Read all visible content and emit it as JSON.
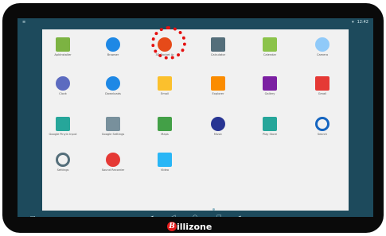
{
  "statusbar": {
    "menu_icon": "menu-icon",
    "time": "12:42"
  },
  "apps": [
    {
      "label": "ApkInstaller",
      "icon": "android-icon",
      "color": "#7cb342"
    },
    {
      "label": "Browser",
      "icon": "globe-icon",
      "color": "#1e88e5"
    },
    {
      "label": "3D Rocket Ar",
      "icon": "game-icon",
      "color": "#e64a19"
    },
    {
      "label": "Calculator",
      "icon": "calculator-icon",
      "color": "#546e7a"
    },
    {
      "label": "Calendar",
      "icon": "calendar-icon",
      "color": "#8bc34a"
    },
    {
      "label": "Camera",
      "icon": "camera-icon",
      "color": "#90caf9"
    },
    {
      "label": "Clock",
      "icon": "clock-icon",
      "color": "#5c6bc0"
    },
    {
      "label": "Downloads",
      "icon": "download-icon",
      "color": "#1e88e5"
    },
    {
      "label": "Email",
      "icon": "email-icon",
      "color": "#fbc02d"
    },
    {
      "label": "Explorer",
      "icon": "folder-icon",
      "color": "#fb8c00"
    },
    {
      "label": "Gallery",
      "icon": "gallery-icon",
      "color": "#7b1fa2"
    },
    {
      "label": "Gmail",
      "icon": "gmail-icon",
      "color": "#e53935"
    },
    {
      "label": "Google Pinyin Input",
      "icon": "keyboard-icon",
      "color": "#26a69a"
    },
    {
      "label": "Google Settings",
      "icon": "google-settings-icon",
      "color": "#78909c"
    },
    {
      "label": "Maps",
      "icon": "maps-icon",
      "color": "#43a047"
    },
    {
      "label": "Music",
      "icon": "music-icon",
      "color": "#283593"
    },
    {
      "label": "Play Store",
      "icon": "play-store-icon",
      "color": "#26a69a"
    },
    {
      "label": "Search",
      "icon": "search-icon",
      "color": "#1565c0"
    },
    {
      "label": "Settings",
      "icon": "settings-icon",
      "color": "#546e7a"
    },
    {
      "label": "Sound Recorder",
      "icon": "microphone-icon",
      "color": "#e53935"
    },
    {
      "label": "Video",
      "icon": "video-icon",
      "color": "#29b6f6"
    }
  ],
  "navbar": {
    "screenshot_icon": "screenshot-icon",
    "volume_down_icon": "volume-down-icon",
    "back_icon": "back-icon",
    "home_icon": "home-icon",
    "recents_icon": "recents-icon",
    "volume_up_icon": "volume-up-icon"
  },
  "brand": {
    "mark": "B",
    "name": "illizone"
  }
}
